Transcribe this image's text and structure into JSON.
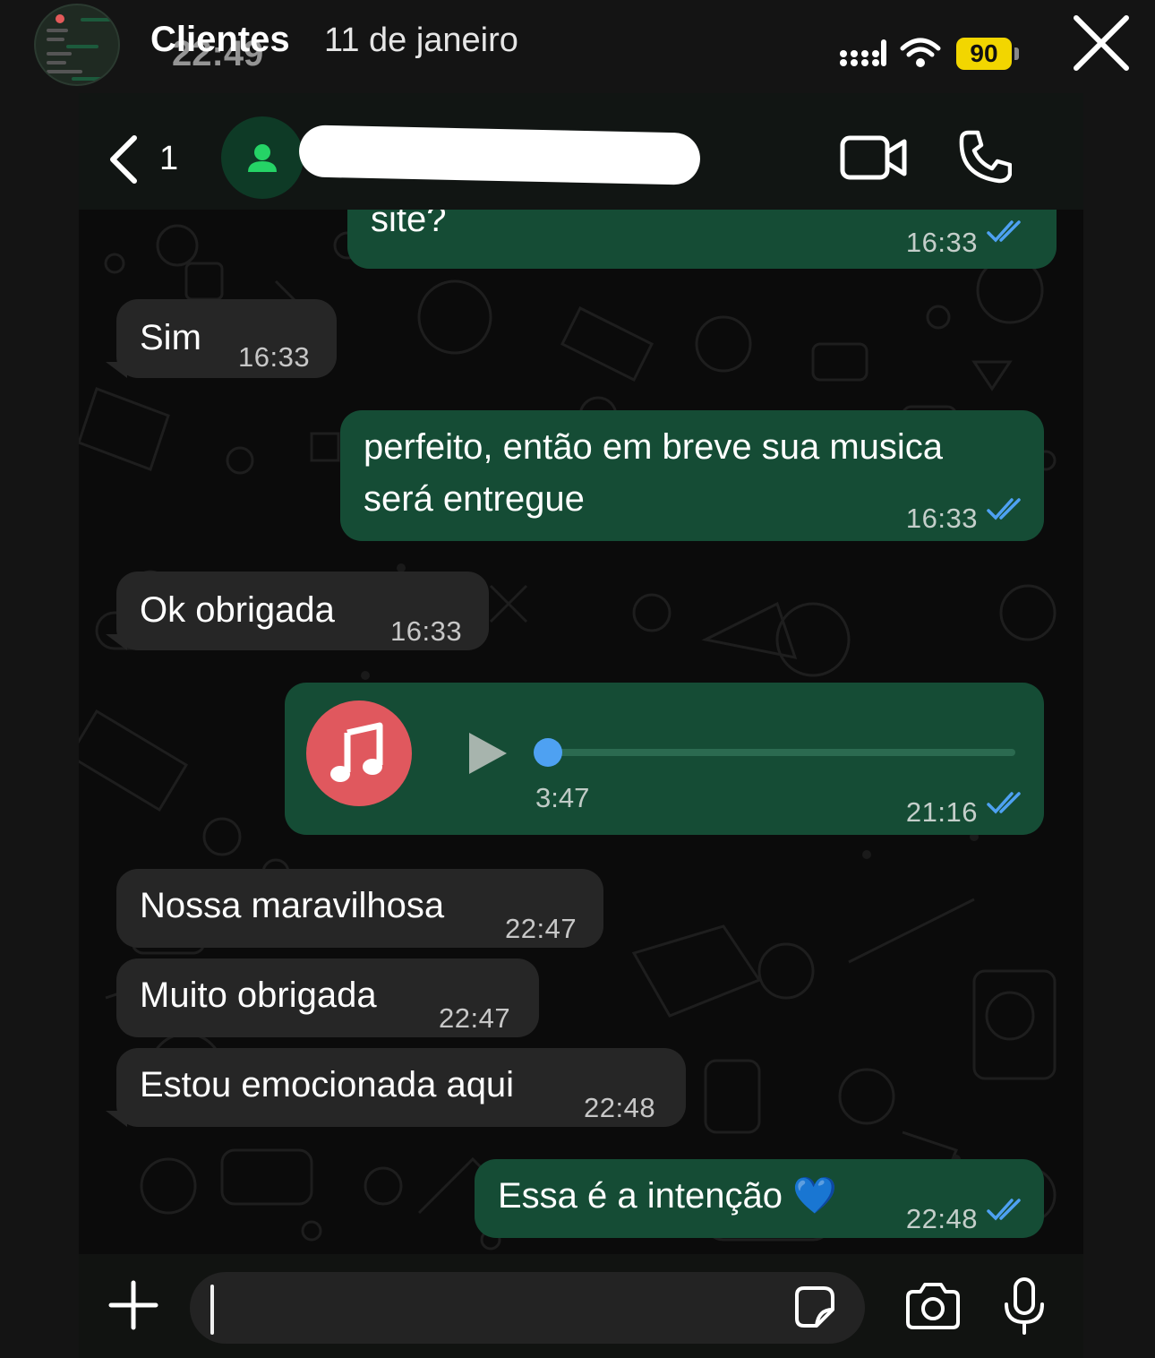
{
  "story": {
    "title": "Clientes",
    "time": "22:49",
    "date": "11 de janeiro",
    "battery": "90",
    "close_icon": "close-icon"
  },
  "chat": {
    "back_count": "1",
    "icons": [
      "chevron-left-icon",
      "person-icon",
      "video-camera-icon",
      "phone-icon"
    ]
  },
  "messages": [
    {
      "direction": "out",
      "text": "site?",
      "time": "16:33",
      "status": "read"
    },
    {
      "direction": "in",
      "text": "Sim",
      "time": "16:33"
    },
    {
      "direction": "out",
      "text_line1": "perfeito, então em breve sua musica",
      "text_line2": "será entregue",
      "time": "16:33",
      "status": "read"
    },
    {
      "direction": "in",
      "text": "Ok obrigada",
      "time": "16:33"
    },
    {
      "direction": "out",
      "type": "audio",
      "duration": "3:47",
      "time": "21:16",
      "status": "read",
      "progress": 0
    },
    {
      "direction": "in",
      "text": "Nossa maravilhosa",
      "time": "22:47"
    },
    {
      "direction": "in",
      "text": "Muito obrigada",
      "time": "22:47"
    },
    {
      "direction": "in",
      "text": "Estou emocionada aqui",
      "time": "22:48"
    },
    {
      "direction": "out",
      "text": "Essa é a intenção 💙",
      "time": "22:48",
      "status": "read"
    }
  ],
  "input": {
    "placeholder": "",
    "icons": [
      "plus-icon",
      "sticker-icon",
      "camera-icon",
      "microphone-icon"
    ]
  },
  "colors": {
    "outgoing_bubble": "#154c35",
    "incoming_bubble": "#262626",
    "read_ticks": "#4ea1f2",
    "battery": "#f2d600",
    "audio_art": "#e0585e"
  }
}
